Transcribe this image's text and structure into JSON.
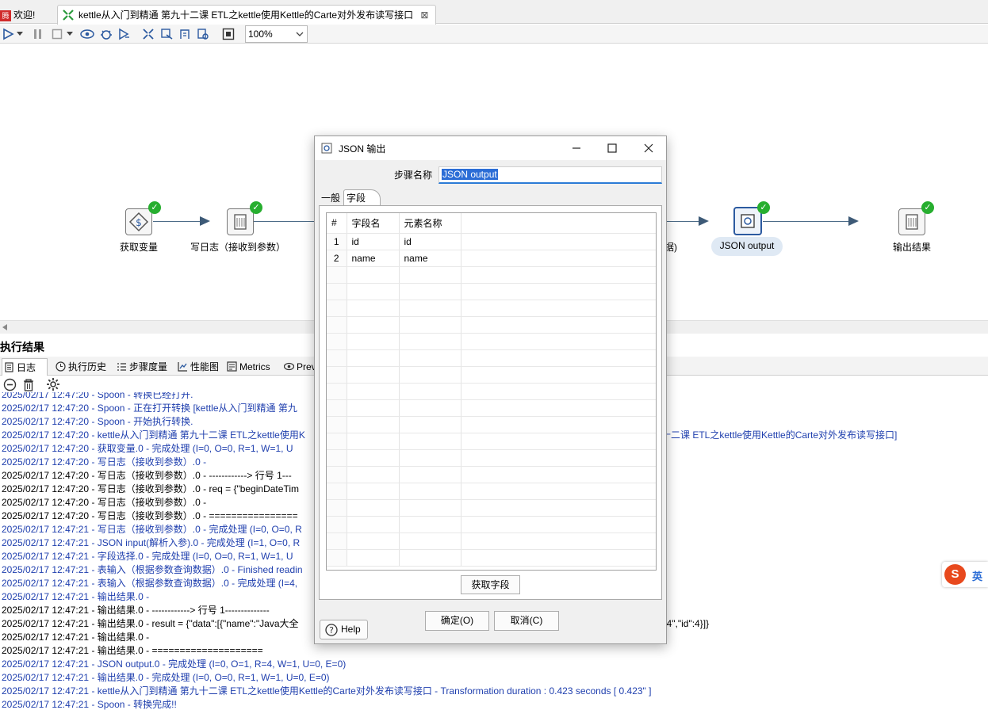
{
  "tabs": {
    "welcome": "欢迎!",
    "main": "kettle从入门到精通 第九十二课 ETL之kettle使用Kettle的Carte对外发布读写接口",
    "close_glyph": "⊠"
  },
  "toolbar": {
    "zoom": "100%"
  },
  "canvas": {
    "nodes": [
      {
        "id": "get-variables",
        "label": "获取变量"
      },
      {
        "id": "write-log-params",
        "label": "写日志（接收到参数）"
      },
      {
        "id": "hidden-step-suffix",
        "label": "据)"
      },
      {
        "id": "json-output",
        "label": "JSON output"
      },
      {
        "id": "output-result",
        "label": "输出结果"
      }
    ]
  },
  "results": {
    "title": "执行结果",
    "tabs": [
      {
        "label": "日志"
      },
      {
        "label": "执行历史"
      },
      {
        "label": "步骤度量"
      },
      {
        "label": "性能图"
      },
      {
        "label": "Metrics"
      },
      {
        "label": "Prev"
      }
    ],
    "log": [
      {
        "ts": "2025/02/17 12:47:20",
        "msg": " - Spoon - 转换已经打开.",
        "color": "#1f3fae"
      },
      {
        "ts": "2025/02/17 12:47:20",
        "msg": " - Spoon - 正在打开转换 [kettle从入门到精通 第九",
        "color": "#1f3fae"
      },
      {
        "ts": "2025/02/17 12:47:20",
        "msg": " - Spoon - 开始执行转换.",
        "color": "#1f3fae"
      },
      {
        "ts": "2025/02/17 12:47:20",
        "msg": " - kettle从入门到精通 第九十二课 ETL之kettle使用K",
        "color": "#1f3fae",
        "tail": "十二课 ETL之kettle使用Kettle的Carte对外发布读写接口]"
      },
      {
        "ts": "2025/02/17 12:47:20",
        "msg": " - 获取变量.0 - 完成处理 (I=0, O=0, R=1, W=1, U",
        "color": "#1f3fae"
      },
      {
        "ts": "2025/02/17 12:47:20",
        "msg": " - 写日志（接收到参数）.0 -",
        "color": "#1f3fae"
      },
      {
        "ts": "2025/02/17 12:47:20",
        "msg": " - 写日志（接收到参数）.0 - ------------> 行号 1---",
        "color": "#000000"
      },
      {
        "ts": "2025/02/17 12:47:20",
        "msg": " - 写日志（接收到参数）.0 - req = {\"beginDateTim",
        "color": "#000000"
      },
      {
        "ts": "2025/02/17 12:47:20",
        "msg": " - 写日志（接收到参数）.0 -",
        "color": "#000000"
      },
      {
        "ts": "2025/02/17 12:47:20",
        "msg": " - 写日志（接收到参数）.0 - ================",
        "color": "#000000"
      },
      {
        "ts": "2025/02/17 12:47:21",
        "msg": " - 写日志（接收到参数）.0 - 完成处理 (I=0, O=0, R",
        "color": "#1f3fae"
      },
      {
        "ts": "2025/02/17 12:47:21",
        "msg": " - JSON input(解析入参).0 - 完成处理 (I=1, O=0, R",
        "color": "#1f3fae"
      },
      {
        "ts": "2025/02/17 12:47:21",
        "msg": " - 字段选择.0 - 完成处理 (I=0, O=0, R=1, W=1, U",
        "color": "#1f3fae"
      },
      {
        "ts": "2025/02/17 12:47:21",
        "msg": " - 表输入（根据参数查询数据）.0 - Finished readin",
        "color": "#1f3fae"
      },
      {
        "ts": "2025/02/17 12:47:21",
        "msg": " - 表输入（根据参数查询数据）.0 - 完成处理 (I=4,",
        "color": "#1f3fae"
      },
      {
        "ts": "2025/02/17 12:47:21",
        "msg": " - 输出结果.0 -",
        "color": "#1f3fae"
      },
      {
        "ts": "2025/02/17 12:47:21",
        "msg": " - 输出结果.0 - ------------> 行号 1--------------",
        "color": "#000000"
      },
      {
        "ts": "2025/02/17 12:47:21",
        "msg": " - 输出结果.0 - result = {\"data\":[{\"name\":\"Java大全",
        "color": "#000000",
        "tail": ":\"4\",\"id\":4}]}"
      },
      {
        "ts": "2025/02/17 12:47:21",
        "msg": " - 输出结果.0 -",
        "color": "#000000"
      },
      {
        "ts": "2025/02/17 12:47:21",
        "msg": " - 输出结果.0 - ====================",
        "color": "#000000"
      },
      {
        "ts": "2025/02/17 12:47:21",
        "msg": " - JSON output.0 - 完成处理 (I=0, O=1, R=4, W=1, U=0, E=0)",
        "color": "#1f3fae"
      },
      {
        "ts": "2025/02/17 12:47:21",
        "msg": " - 输出结果.0 - 完成处理 (I=0, O=0, R=1, W=1, U=0, E=0)",
        "color": "#1f3fae"
      },
      {
        "ts": "2025/02/17 12:47:21",
        "msg": " - kettle从入门到精通 第九十二课 ETL之kettle使用Kettle的Carte对外发布读写接口 - Transformation duration : 0.423 seconds [  0.423\" ]",
        "color": "#1f3fae"
      },
      {
        "ts": "2025/02/17 12:47:21",
        "msg": " - Spoon - 转换完成!!",
        "color": "#1f3fae"
      }
    ]
  },
  "dialog": {
    "title": "JSON 输出",
    "step_name_label": "步骤名称",
    "step_name_value": "JSON output",
    "tabs": {
      "general": "一般",
      "fields": "字段"
    },
    "grid": {
      "headers": [
        "#",
        "字段名",
        "元素名称"
      ],
      "rows": [
        {
          "n": "1",
          "field": "id",
          "element": "id"
        },
        {
          "n": "2",
          "field": "name",
          "element": "name"
        }
      ]
    },
    "get_fields_label": "获取字段",
    "ok_label": "确定(O)",
    "cancel_label": "取消(C)",
    "help_label": "Help"
  },
  "ime": {
    "label": "英"
  },
  "colors": {
    "accent": "#2b6dd6",
    "success": "#27ae2f",
    "log_blue": "#1f3fae",
    "hop": "#3d5a77"
  }
}
